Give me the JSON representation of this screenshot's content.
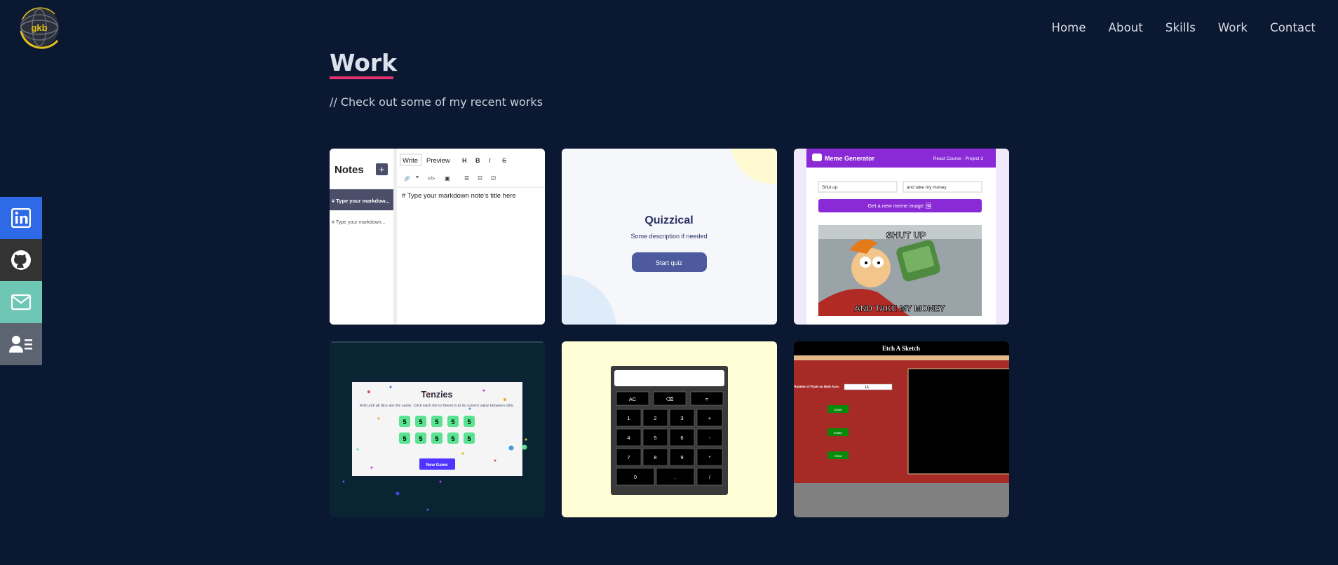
{
  "logo": {
    "icon": "globe-logo-icon",
    "text": "gkb"
  },
  "nav": {
    "items": [
      {
        "label": "Home"
      },
      {
        "label": "About"
      },
      {
        "label": "Skills"
      },
      {
        "label": "Work"
      },
      {
        "label": "Contact"
      }
    ]
  },
  "section": {
    "title": "Work",
    "subtitle": "// Check out some of my recent works"
  },
  "social": [
    {
      "icon": "linkedin-icon",
      "color": "#2f6ae6"
    },
    {
      "icon": "github-icon",
      "color": "#333333"
    },
    {
      "icon": "mail-icon",
      "color": "#6ec6b4"
    },
    {
      "icon": "resume-icon",
      "color": "#5b6470"
    }
  ],
  "projects": {
    "notes": {
      "title": "Notes",
      "add": "+",
      "tab_write": "Write",
      "tab_preview": "Preview",
      "tb_h": "H",
      "tb_b": "B",
      "tb_i": "I",
      "tb_s": "S",
      "tb_link": "🔗",
      "tb_quote": "❞",
      "tb_code": "</>",
      "tb_img": "▣",
      "tb_list": "☰",
      "tb_olist": "☷",
      "tb_check": "☑",
      "note1": "# Type your markdow...",
      "note2": "# Type your markdown...",
      "editor_text": "# Type your markdown note's title here"
    },
    "quizzical": {
      "title": "Quizzical",
      "description": "Some description if needed",
      "button": "Start quiz"
    },
    "meme": {
      "brand": "Meme Generator",
      "course": "React Course - Project 3",
      "input1": "Shut up",
      "input2": "and take my money",
      "button": "Get a new meme image 🖼",
      "top_text": "SHUT UP",
      "bottom_text": "AND TAKE MY MONEY"
    },
    "tenzies": {
      "title": "Tenzies",
      "instructions": "Roll until all dice are the same. Click each die to freeze it at its current value between rolls.",
      "dice": [
        "5",
        "5",
        "5",
        "5",
        "5",
        "5",
        "5",
        "5",
        "5",
        "5"
      ],
      "button": "New Game"
    },
    "calculator": {
      "keys": [
        "AC",
        "⌫",
        "=",
        "1",
        "2",
        "3",
        "+",
        "4",
        "5",
        "6",
        "-",
        "7",
        "8",
        "9",
        "*",
        "0",
        ".",
        "/"
      ]
    },
    "etch": {
      "title": "Etch A Sketch",
      "label": "Number of Pixels on Both Axes:",
      "value": "16",
      "btn_draw": "Draw",
      "btn_erase": "Erase",
      "btn_clear": "Clear"
    }
  }
}
